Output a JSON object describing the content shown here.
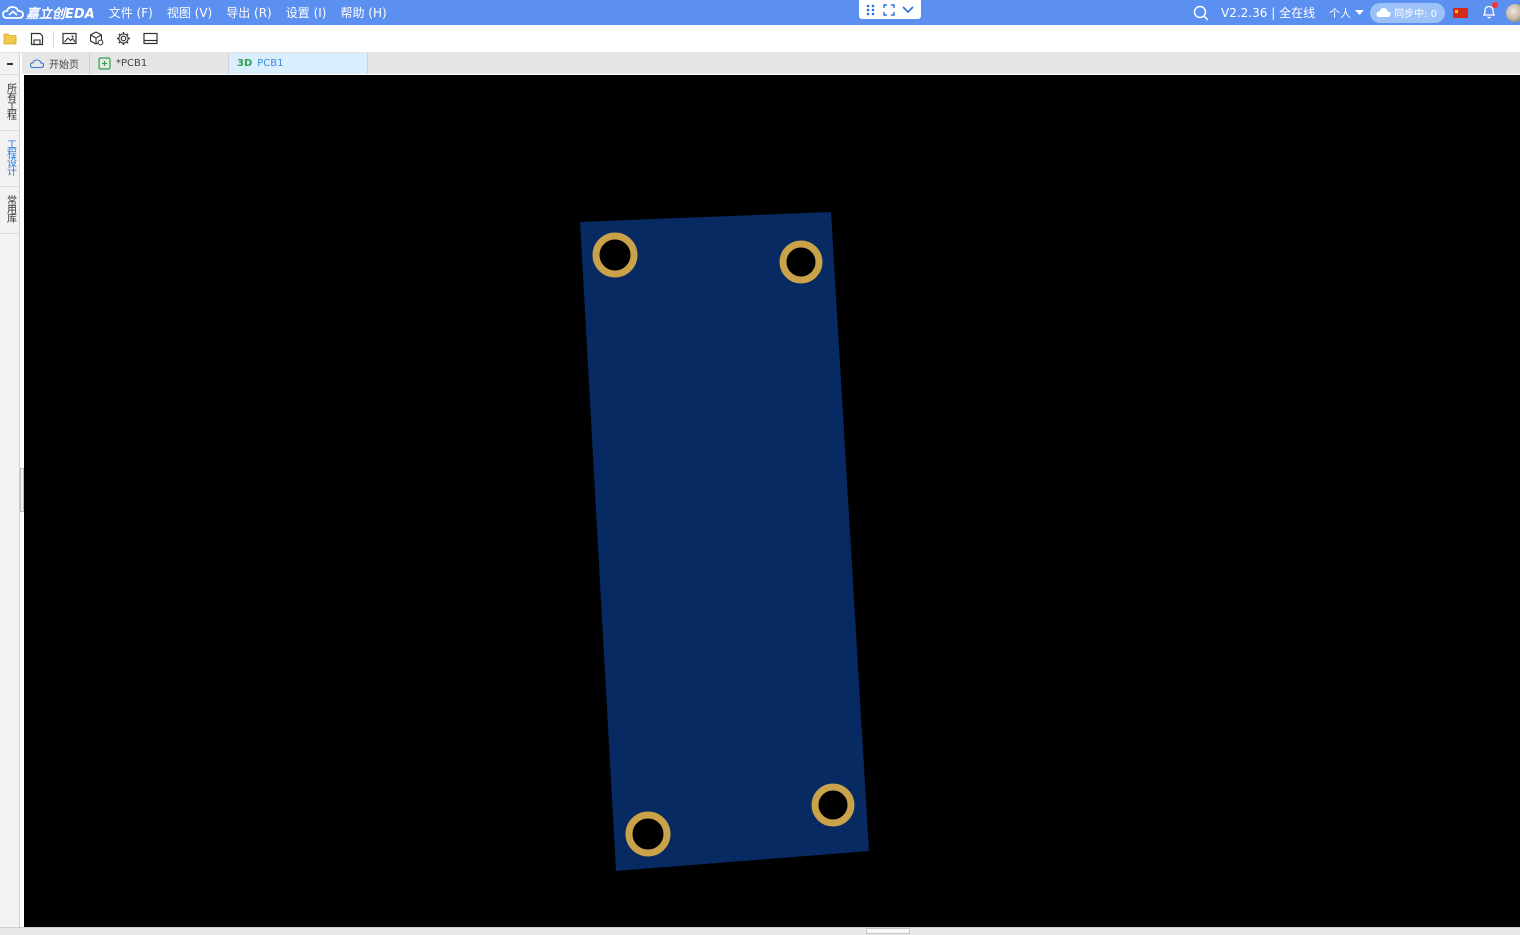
{
  "app": {
    "logo_text": "嘉立创EDA",
    "menus": [
      "文件 (F)",
      "视图 (V)",
      "导出 (R)",
      "设置 (I)",
      "帮助 (H)"
    ],
    "version_status": "V2.2.36 | 全在线",
    "user_menu": "个人",
    "sync_status": "同步中: 0",
    "accent_color": "#5b8ff0"
  },
  "sidebar": {
    "tabs": [
      {
        "label": "所有工程",
        "active": false
      },
      {
        "label": "工程设计",
        "active": true
      },
      {
        "label": "常用库",
        "active": false
      }
    ]
  },
  "tabs": [
    {
      "label": "开始页",
      "icon": "cloud-icon",
      "active": false
    },
    {
      "label": "*PCB1",
      "icon": "pcb-icon",
      "active": false
    },
    {
      "label": "PCB1",
      "prefix": "3D",
      "icon": "3d-icon",
      "active": true
    }
  ],
  "viewport": {
    "background": "#000000",
    "board_color": "#062a61",
    "pad_color": "#c9a24a",
    "hole_count": 4
  }
}
